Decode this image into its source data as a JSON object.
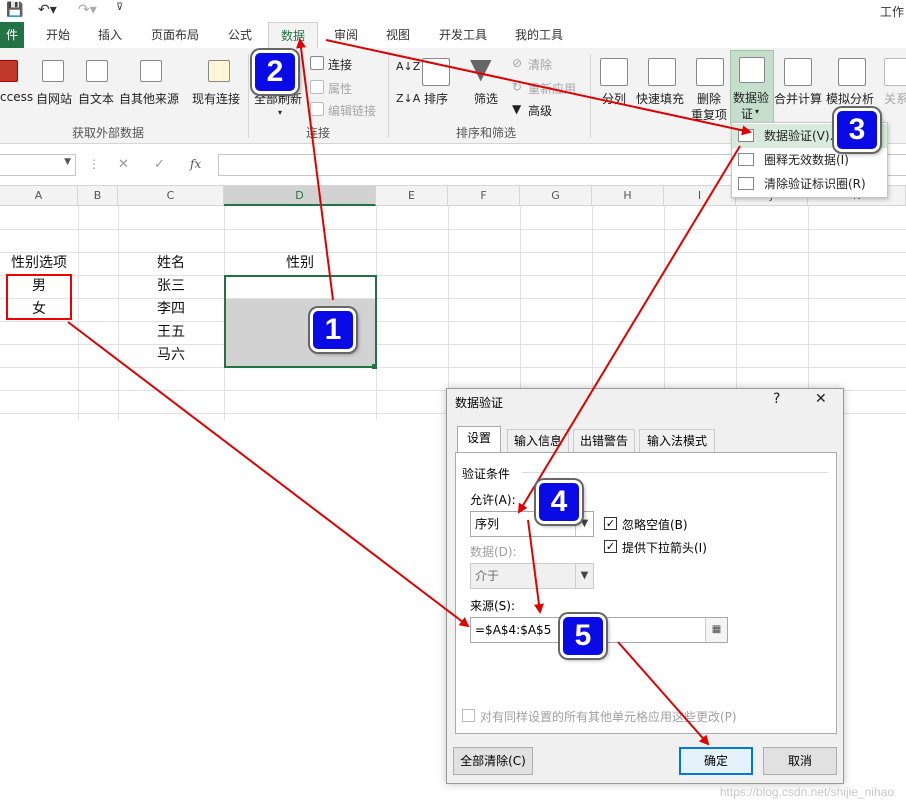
{
  "titlebar": {
    "app_title": "工作"
  },
  "tabs": [
    {
      "label": "件"
    },
    {
      "label": "开始"
    },
    {
      "label": "插入"
    },
    {
      "label": "页面布局"
    },
    {
      "label": "公式"
    },
    {
      "label": "数据"
    },
    {
      "label": "审阅"
    },
    {
      "label": "视图"
    },
    {
      "label": "开发工具"
    },
    {
      "label": "我的工具"
    }
  ],
  "ribbon": {
    "external": {
      "access": "ccess",
      "web": "自网站",
      "text": "自文本",
      "other": "自其他来源",
      "group": "获取外部数据"
    },
    "conn": {
      "existing": "现有连接",
      "refresh": "全部刷新",
      "connections": "连接",
      "properties": "属性",
      "edit_links": "编辑链接",
      "group": "连接"
    },
    "sort": {
      "sort": "排序",
      "filter": "筛选",
      "clear": "清除",
      "reapply": "重新应用",
      "advanced": "高级",
      "group": "排序和筛选"
    },
    "tools": {
      "split": "分列",
      "flash": "快速填充",
      "remove_dup_1": "删除",
      "remove_dup_2": "重复项",
      "validation_1": "数据验",
      "validation_2": "证",
      "consolidate": "合并计算",
      "whatif": "模拟分析",
      "relations": "关系"
    }
  },
  "formula_bar": {
    "fx": "fx"
  },
  "grid": {
    "columns": [
      "A",
      "B",
      "C",
      "D",
      "E",
      "F",
      "G",
      "H",
      "I",
      "J",
      "K"
    ],
    "a_header": "性别选项",
    "a_values": [
      "男",
      "女"
    ],
    "c_header": "姓名",
    "c_values": [
      "张三",
      "李四",
      "王五",
      "马六"
    ],
    "d_header": "性别"
  },
  "dv_menu": {
    "items": [
      {
        "label": "数据验证(V)..."
      },
      {
        "label": "圈释无效数据(I)"
      },
      {
        "label": "清除验证标识圈(R)"
      }
    ]
  },
  "dialog": {
    "title": "数据验证",
    "help": "?",
    "close": "✕",
    "tabs": [
      "设置",
      "输入信息",
      "出错警告",
      "输入法模式"
    ],
    "criteria_label": "验证条件",
    "allow_label": "允许(A):",
    "allow_value": "序列",
    "ignore_blank": "忽略空值(B)",
    "dropdown_arrow": "提供下拉箭头(I)",
    "data_label": "数据(D):",
    "data_value": "介于",
    "source_label": "来源(S):",
    "source_value": "=$A$4:$A$5",
    "apply_all": "对有同样设置的所有其他单元格应用这些更改(P)",
    "clear_all": "全部清除(C)",
    "ok": "确定",
    "cancel": "取消"
  },
  "badges": [
    "1",
    "2",
    "3",
    "4",
    "5"
  ],
  "watermark": "https://blog.csdn.net/shijie_nihao",
  "colors": {
    "excel_green": "#217346",
    "badge_blue": "#0a0ae6",
    "arrow_red": "#e00000"
  }
}
